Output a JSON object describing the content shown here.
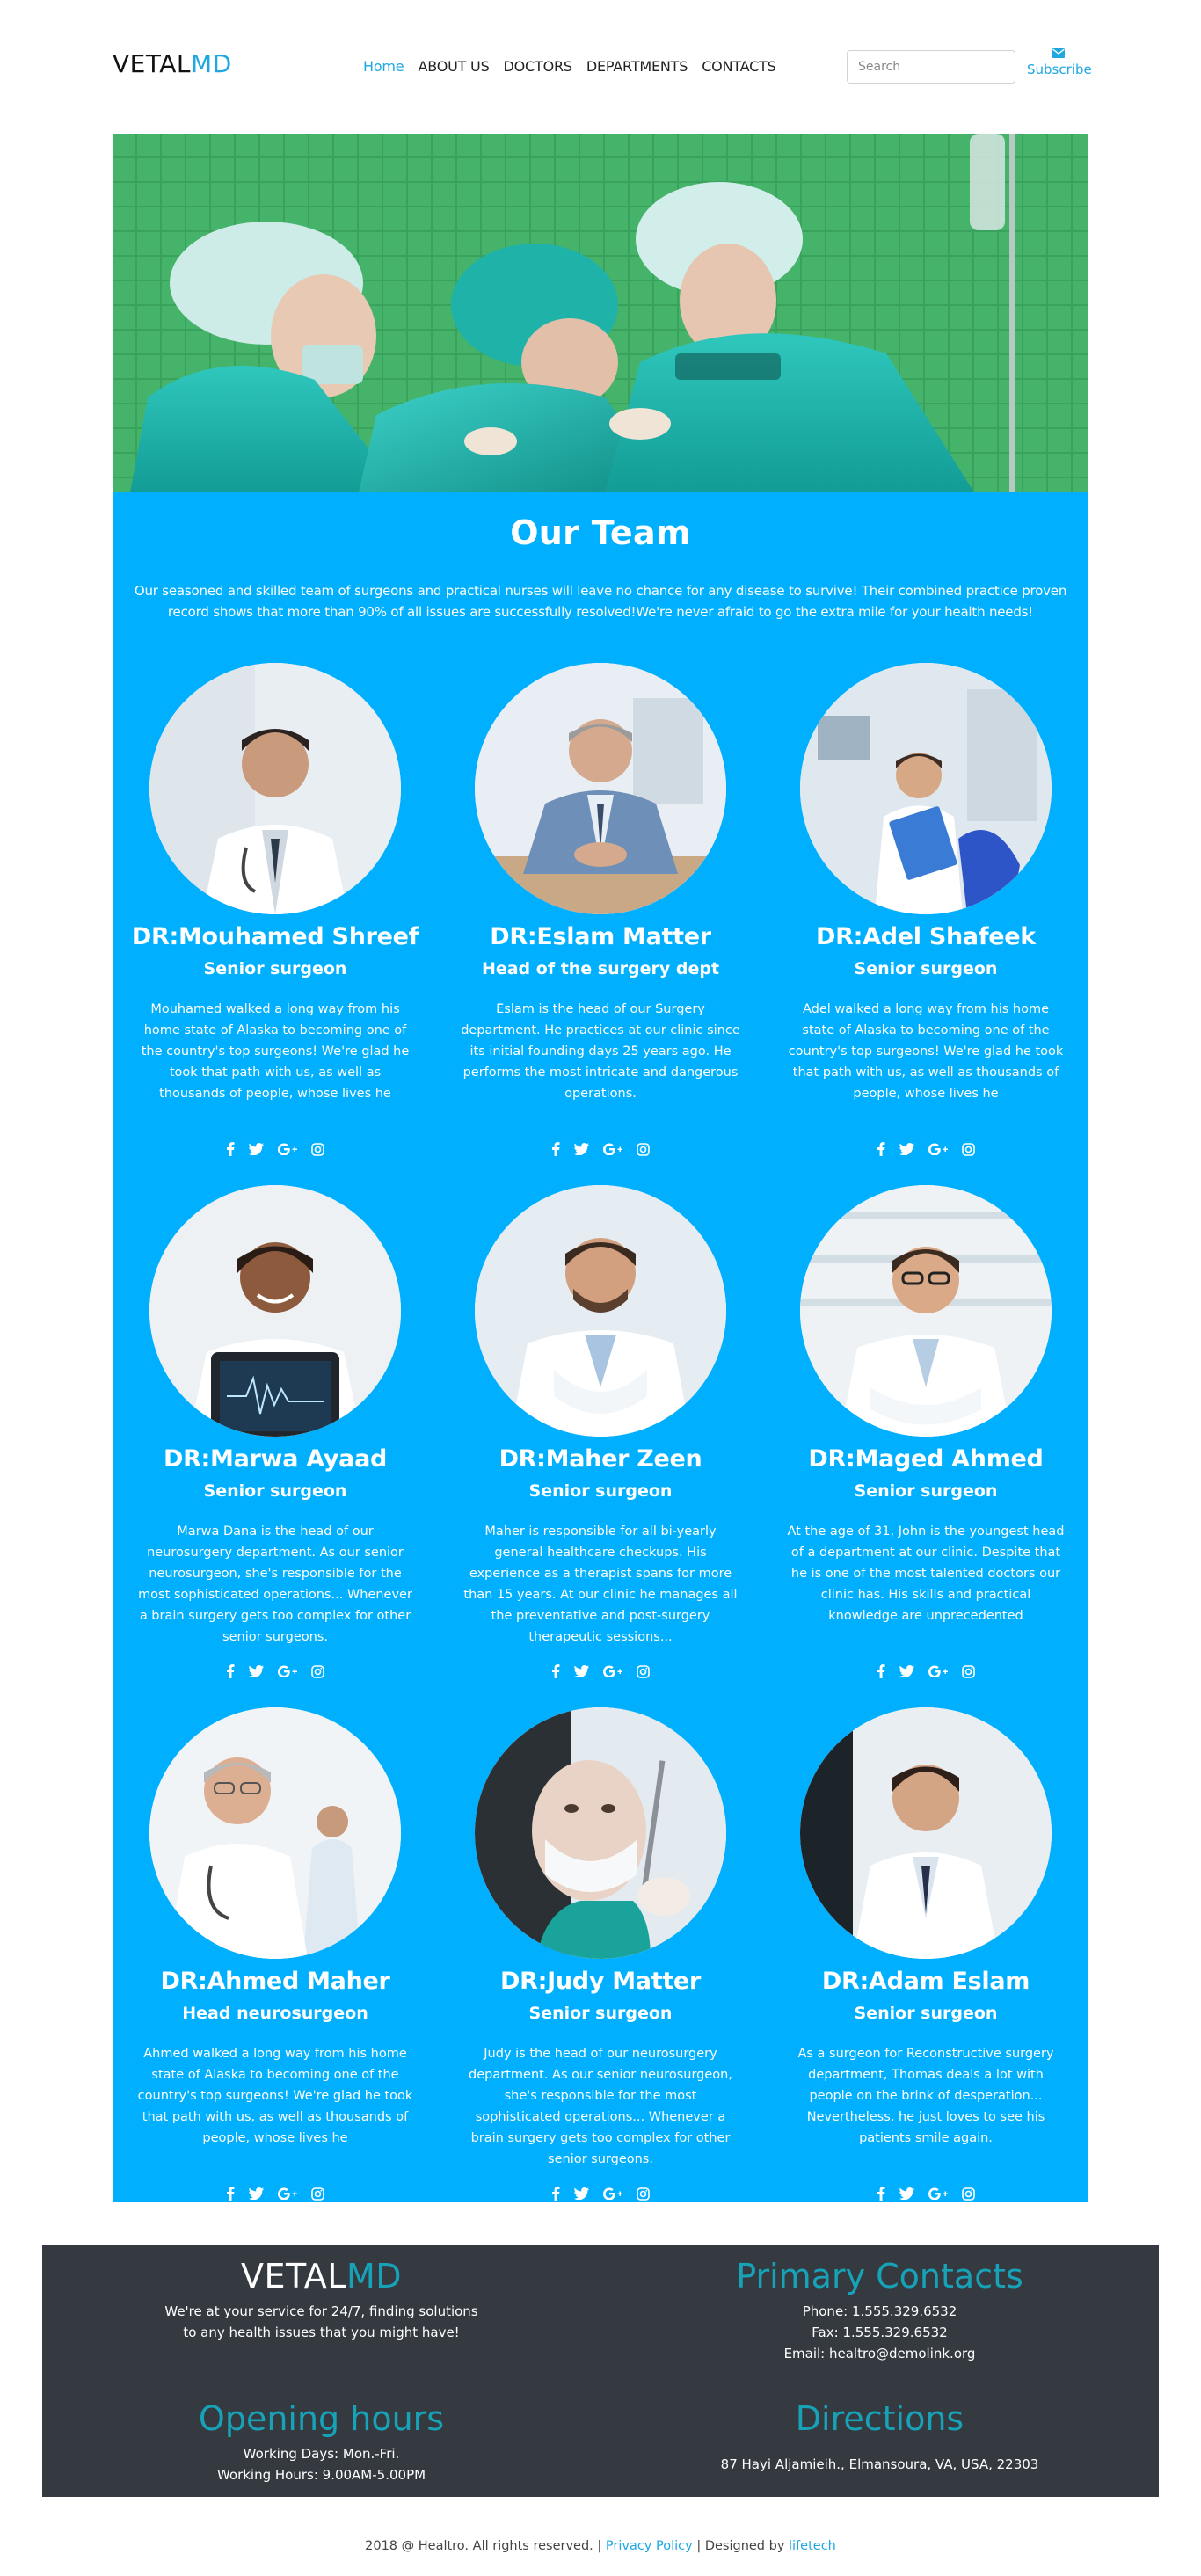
{
  "brand": {
    "part1": "VETAL",
    "part2": "MD"
  },
  "nav": {
    "items": [
      {
        "label": "Home",
        "active": true
      },
      {
        "label": "ABOUT US",
        "active": false
      },
      {
        "label": "DOCTORS",
        "active": false
      },
      {
        "label": "DEPARTMENTS",
        "active": false
      },
      {
        "label": "CONTACTS",
        "active": false
      }
    ]
  },
  "search": {
    "placeholder": "Search",
    "value": ""
  },
  "subscribe": {
    "label": "Subscribe",
    "icon": "envelope-icon"
  },
  "hero": {
    "image": "surgical-team-photo"
  },
  "team": {
    "title": "Our Team",
    "intro": "Our seasoned and skilled team of surgeons and practical nurses will leave no chance for any disease to survive! Their combined practice proven record shows that more than 90% of all issues are successfully resolved!We're never afraid to go the extra mile for your health needs!",
    "doctors": [
      {
        "name": "DR:Mouhamed Shreef",
        "role": "Senior surgeon",
        "bio": "Mouhamed walked a long way from his home state of Alaska to becoming one of the country's top surgeons! We're glad he took that path with us, as well as thousands of people, whose lives he"
      },
      {
        "name": "DR:Eslam Matter",
        "role": "Head of the surgery dept",
        "bio": "Eslam is the head of our Surgery department. He practices at our clinic since its initial founding days 25 years ago. He performs the most intricate and dangerous operations."
      },
      {
        "name": "DR:Adel Shafeek",
        "role": "Senior surgeon",
        "bio": "Adel walked a long way from his home state of Alaska to becoming one of the country's top surgeons! We're glad he took that path with us, as well as thousands of people, whose lives he"
      },
      {
        "name": "DR:Marwa Ayaad",
        "role": "Senior surgeon",
        "bio": "Marwa Dana is the head of our neurosurgery department. As our senior neurosurgeon, she's responsible for the most sophisticated operations... Whenever a brain surgery gets too complex for other senior surgeons."
      },
      {
        "name": "DR:Maher Zeen",
        "role": "Senior surgeon",
        "bio": "Maher is responsible for all bi-yearly general healthcare checkups. His experience as a therapist spans for more than 15 years. At our clinic he manages all the preventative and post-surgery therapeutic sessions..."
      },
      {
        "name": "DR:Maged Ahmed",
        "role": "Senior surgeon",
        "bio": "At the age of 31, John is the youngest head of a department at our clinic. Despite that he is one of the most talented doctors our clinic has. His skills and practical knowledge are unprecedented"
      },
      {
        "name": "DR:Ahmed Maher",
        "role": "Head neurosurgeon",
        "bio": "Ahmed walked a long way from his home state of Alaska to becoming one of the country's top surgeons! We're glad he took that path with us, as well as thousands of people, whose lives he"
      },
      {
        "name": "DR:Judy Matter",
        "role": "Senior surgeon",
        "bio": "Judy is the head of our neurosurgery department. As our senior neurosurgeon, she's responsible for the most sophisticated operations... Whenever a brain surgery gets too complex for other senior surgeons."
      },
      {
        "name": "DR:Adam Eslam",
        "role": "Senior surgeon",
        "bio": "As a surgeon for Reconstructive surgery department, Thomas deals a lot with people on the brink of desperation... Nevertheless, he just loves to see his patients smile again."
      }
    ],
    "social_icons": [
      "facebook-icon",
      "twitter-icon",
      "google-plus-icon",
      "instagram-icon"
    ]
  },
  "footer": {
    "brand": {
      "part1": "VETAL",
      "part2": "MD"
    },
    "tagline_line1": "We're at your service for 24/7, finding solutions",
    "tagline_line2": "to any health issues that you might have!",
    "contacts_title": "Primary Contacts",
    "phone": "Phone: 1.555.329.6532",
    "fax": "Fax: 1.555.329.6532",
    "email": "Email: healtro@demolink.org",
    "hours_title": "Opening hours",
    "working_days": "Working Days: Mon.-Fri.",
    "working_hours": "Working Hours: 9.00AM-5.00PM",
    "directions_title": "Directions",
    "address": "87 Hayi Aljamieih., Elmansoura, VA, USA, 22303"
  },
  "copyright": {
    "text": "2018 @ Healtro. All rights reserved. |",
    "privacy": "Privacy Policy",
    "designed_by": "| Designed by",
    "designer": "lifetech"
  },
  "colors": {
    "accent": "#1ea7e1",
    "team_bg": "#00b0ff",
    "footer_bg": "#343a40",
    "footer_heading": "#17a2b8"
  }
}
